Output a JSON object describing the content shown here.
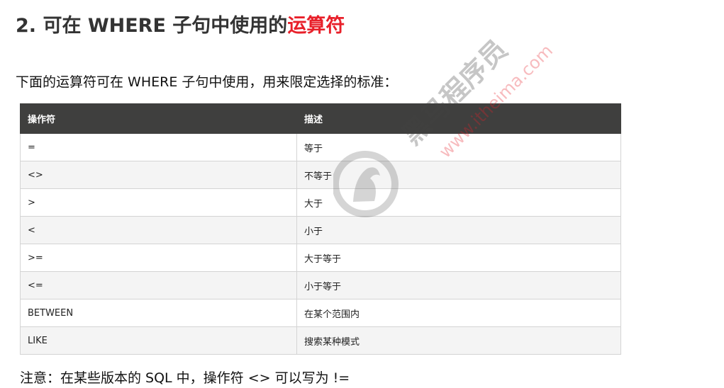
{
  "heading": {
    "number": "2.",
    "text": "可在 WHERE 子句中使用的",
    "highlight": "运算符"
  },
  "intro": "下面的运算符可在 WHERE 子句中使用，用来限定选择的标准：",
  "table": {
    "headers": [
      "操作符",
      "描述"
    ],
    "rows": [
      [
        "=",
        "等于"
      ],
      [
        "<>",
        "不等于"
      ],
      [
        ">",
        "大于"
      ],
      [
        "<",
        "小于"
      ],
      [
        ">=",
        "大于等于"
      ],
      [
        "<=",
        "小于等于"
      ],
      [
        "BETWEEN",
        "在某个范围内"
      ],
      [
        "LIKE",
        "搜索某种模式"
      ]
    ]
  },
  "note": "注意：在某些版本的 SQL 中，操作符 <> 可以写为 !=",
  "watermark": {
    "brand": "黑马程序员",
    "url": "www.itheima.com"
  },
  "colors": {
    "header_bg": "#3f3f3e",
    "accent_red": "#e8202a",
    "row_alt": "#f4f4f4"
  }
}
